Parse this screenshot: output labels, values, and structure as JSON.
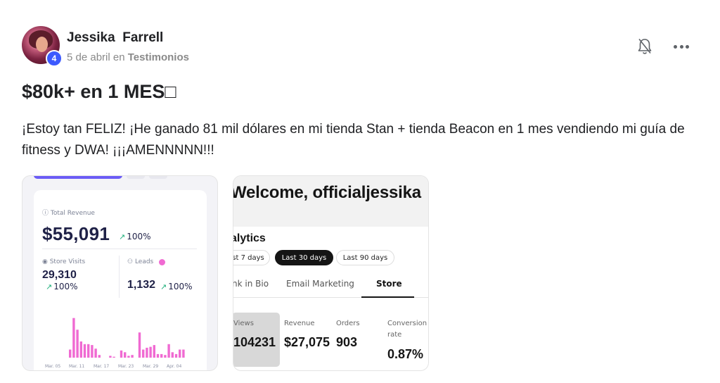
{
  "post": {
    "author": "Jessika  Farrell",
    "level": "4",
    "date": "5 de abril en ",
    "category": "Testimonios",
    "title": "$80k+ en 1 MES",
    "title_glyph": "□",
    "body": "¡Estoy tan FELIZ! ¡He ganado 81 mil dólares en mi tienda Stan + tienda Beacon en 1 mes vendiendo mi guía de fitness y DWA! ¡¡¡AMENNNNN!!!"
  },
  "actions": {
    "notify_icon": "bell-off-icon",
    "more_icon": "more-horizontal-icon"
  },
  "dashboard": {
    "total_revenue_label": "Total Revenue",
    "total_revenue": "$55,091",
    "total_revenue_change": "100%",
    "store_visits_label": "Store Visits",
    "store_visits": "29,310",
    "store_visits_change": "100%",
    "leads_label": "Leads",
    "leads": "1,132",
    "leads_change": "100%",
    "accent_color": "#f06ad2",
    "dates": [
      "Mar. 05",
      "Mar. 11",
      "Mar. 17",
      "Mar. 23",
      "Mar. 29",
      "Apr. 04"
    ],
    "bars": [
      0,
      0,
      0,
      0,
      0,
      9,
      44,
      31,
      18,
      15,
      15,
      14,
      10,
      3,
      0,
      0,
      2,
      1,
      0,
      8,
      6,
      2,
      3,
      0,
      28,
      9,
      11,
      12,
      14,
      4,
      4,
      3,
      15,
      6,
      4,
      9,
      9
    ]
  },
  "stan": {
    "welcome": "Welcome, officialjessika",
    "analytics": "alytics",
    "chips": [
      {
        "label": "st 7 days",
        "active": false
      },
      {
        "label": "Last 30 days",
        "active": true
      },
      {
        "label": "Last 90 days",
        "active": false
      }
    ],
    "tabs": [
      {
        "label": "nk in Bio",
        "active": false
      },
      {
        "label": "Email Marketing",
        "active": false
      },
      {
        "label": "Store",
        "active": true
      }
    ],
    "stats": {
      "views_label": "Views",
      "views": "104231",
      "revenue_label": "Revenue",
      "revenue": "$27,075",
      "orders_label": "Orders",
      "orders": "903",
      "conversion_label_1": "Conversion",
      "conversion_label_2": "rate",
      "conversion": "0.87%"
    }
  }
}
